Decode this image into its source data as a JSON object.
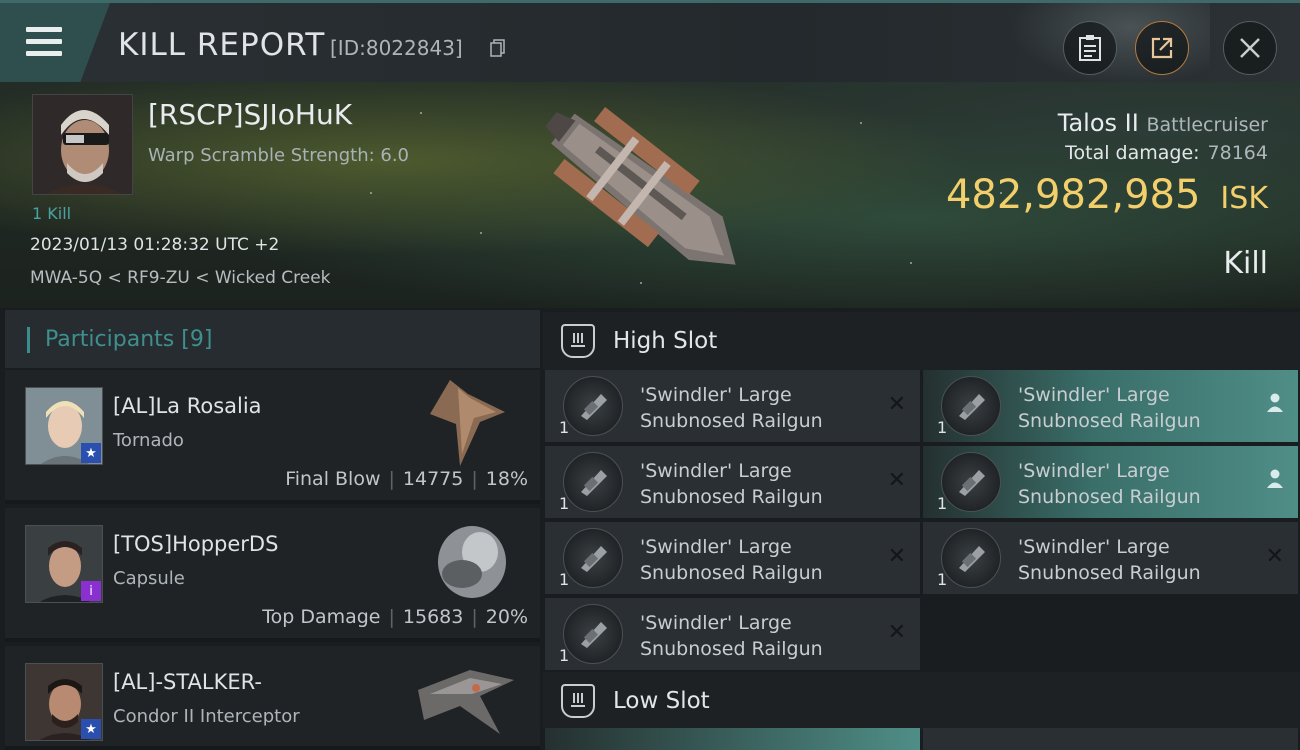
{
  "header": {
    "title": "KILL REPORT",
    "report_id": "[ID:8022843]"
  },
  "victim": {
    "name": "[RSCP]SJIoHuK",
    "warp_scramble": "Warp Scramble Strength: 6.0",
    "kill_count": "1 Kill",
    "date": "2023/01/13 01:28:32 UTC +2",
    "location": "MWA-5Q < RF9-ZU < Wicked Creek"
  },
  "ship": {
    "name": "Talos II",
    "class": "Battlecruiser",
    "total_damage_label": "Total damage:",
    "total_damage": "78164",
    "isk_value": "482,982,985",
    "isk_unit": "ISK",
    "result": "Kill"
  },
  "participants": {
    "label": "Participants",
    "count": "[9]",
    "items": [
      {
        "name": "[AL]La Rosalia",
        "ship": "Tornado",
        "role": "Final Blow",
        "damage": "14775",
        "percent": "18%",
        "badge": "★"
      },
      {
        "name": "[TOS]HopperDS",
        "ship": "Capsule",
        "role": "Top Damage",
        "damage": "15683",
        "percent": "20%",
        "badge": "i"
      },
      {
        "name": "[AL]-STALKER-",
        "ship": "Condor II Interceptor",
        "badge": "★"
      }
    ]
  },
  "slots": {
    "high_label": "High Slot",
    "low_label": "Low Slot",
    "high_items": [
      {
        "qty": "1",
        "line1": "'Swindler' Large",
        "line2": "Snubnosed Railgun",
        "status": "✕"
      },
      {
        "qty": "1",
        "line1": "'Swindler' Large",
        "line2": "Snubnosed Railgun",
        "status": "✕"
      },
      {
        "qty": "1",
        "line1": "'Swindler' Large",
        "line2": "Snubnosed Railgun",
        "status": "✕"
      },
      {
        "qty": "1",
        "line1": "'Swindler' Large",
        "line2": "Snubnosed Railgun",
        "status": "✕"
      },
      {
        "qty": "1",
        "line1": "'Swindler' Large",
        "line2": "Snubnosed Railgun",
        "status": "person-icon"
      },
      {
        "qty": "1",
        "line1": "'Swindler' Large",
        "line2": "Snubnosed Railgun",
        "status": "person-icon"
      },
      {
        "qty": "1",
        "line1": "'Swindler' Large",
        "line2": "Snubnosed Railgun",
        "status": "✕"
      }
    ]
  },
  "colors": {
    "accent_teal": "#3f8f8f",
    "isk_gold": "#f2cf6a",
    "dropped_teal": "#4f8e87"
  }
}
